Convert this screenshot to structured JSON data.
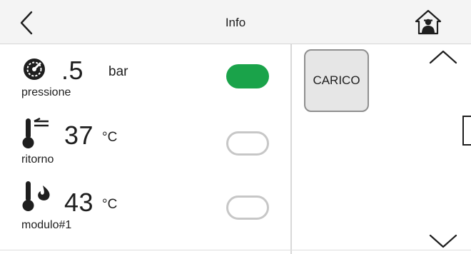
{
  "header": {
    "title": "Info",
    "back_icon": "chevron-left-icon",
    "home_icon": "home-user-icon"
  },
  "rows": [
    {
      "icon": "pressure-gauge-icon",
      "value": ".5",
      "unit": "bar",
      "label": "pressione",
      "toggle_on": true
    },
    {
      "icon": "thermometer-return-icon",
      "value": "37",
      "unit": "°C",
      "label": "ritorno",
      "toggle_on": false
    },
    {
      "icon": "thermometer-flame-icon",
      "value": "43",
      "unit": "°C",
      "label": "modulo#1",
      "toggle_on": false
    }
  ],
  "actions": {
    "carico_label": "CARICO"
  },
  "colors": {
    "toggle_on": "#1aa34a",
    "toggle_off_border": "#c7c7c7",
    "header_bg": "#f4f4f4",
    "text": "#1e1e1e"
  }
}
